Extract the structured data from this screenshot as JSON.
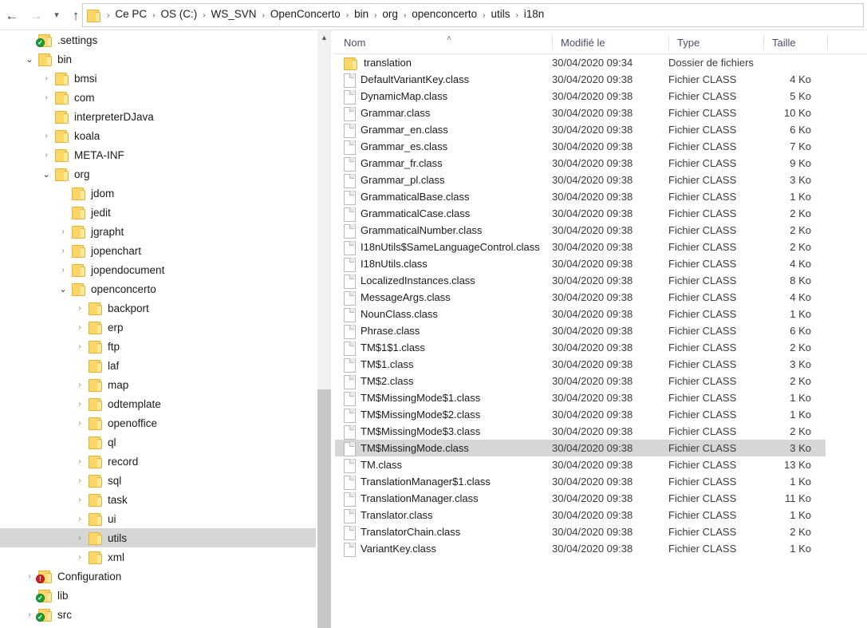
{
  "navigation": {
    "back_icon": "arrow-left-icon",
    "forward_icon": "arrow-right-icon",
    "recent_icon": "chevron-down-icon",
    "up_icon": "arrow-up-icon",
    "breadcrumb_icon": "folder-icon",
    "separator": "›",
    "breadcrumbs": [
      "Ce PC",
      "OS (C:)",
      "WS_SVN",
      "OpenConcerto",
      "bin",
      "org",
      "openconcerto",
      "utils",
      "i18n"
    ]
  },
  "sidebar": {
    "scroll_up_icon": "chevron-up-icon",
    "items": [
      {
        "label": ".settings",
        "depth": 1,
        "state": "leaf",
        "icon": "folder-icon",
        "overlay": "svn-ok-badge",
        "selected": false
      },
      {
        "label": "bin",
        "depth": 1,
        "state": "expanded",
        "icon": "folder-icon",
        "overlay": null,
        "selected": false
      },
      {
        "label": "bmsi",
        "depth": 2,
        "state": "collapsed",
        "icon": "folder-icon",
        "overlay": null,
        "selected": false
      },
      {
        "label": "com",
        "depth": 2,
        "state": "collapsed",
        "icon": "folder-icon",
        "overlay": null,
        "selected": false
      },
      {
        "label": "interpreterDJava",
        "depth": 2,
        "state": "leaf",
        "icon": "folder-icon",
        "overlay": null,
        "selected": false
      },
      {
        "label": "koala",
        "depth": 2,
        "state": "collapsed",
        "icon": "folder-icon",
        "overlay": null,
        "selected": false
      },
      {
        "label": "META-INF",
        "depth": 2,
        "state": "collapsed",
        "icon": "folder-icon",
        "overlay": null,
        "selected": false
      },
      {
        "label": "org",
        "depth": 2,
        "state": "expanded",
        "icon": "folder-icon",
        "overlay": null,
        "selected": false
      },
      {
        "label": "jdom",
        "depth": 3,
        "state": "leaf",
        "icon": "folder-icon",
        "overlay": null,
        "selected": false
      },
      {
        "label": "jedit",
        "depth": 3,
        "state": "leaf",
        "icon": "folder-icon",
        "overlay": null,
        "selected": false
      },
      {
        "label": "jgrapht",
        "depth": 3,
        "state": "collapsed",
        "icon": "folder-icon",
        "overlay": null,
        "selected": false
      },
      {
        "label": "jopenchart",
        "depth": 3,
        "state": "collapsed",
        "icon": "folder-icon",
        "overlay": null,
        "selected": false
      },
      {
        "label": "jopendocument",
        "depth": 3,
        "state": "collapsed",
        "icon": "folder-icon",
        "overlay": null,
        "selected": false
      },
      {
        "label": "openconcerto",
        "depth": 3,
        "state": "expanded",
        "icon": "folder-icon",
        "overlay": null,
        "selected": false
      },
      {
        "label": "backport",
        "depth": 4,
        "state": "collapsed",
        "icon": "folder-icon",
        "overlay": null,
        "selected": false
      },
      {
        "label": "erp",
        "depth": 4,
        "state": "collapsed",
        "icon": "folder-icon",
        "overlay": null,
        "selected": false
      },
      {
        "label": "ftp",
        "depth": 4,
        "state": "collapsed",
        "icon": "folder-icon",
        "overlay": null,
        "selected": false
      },
      {
        "label": "laf",
        "depth": 4,
        "state": "leaf",
        "icon": "folder-icon",
        "overlay": null,
        "selected": false
      },
      {
        "label": "map",
        "depth": 4,
        "state": "collapsed",
        "icon": "folder-icon",
        "overlay": null,
        "selected": false
      },
      {
        "label": "odtemplate",
        "depth": 4,
        "state": "collapsed",
        "icon": "folder-icon",
        "overlay": null,
        "selected": false
      },
      {
        "label": "openoffice",
        "depth": 4,
        "state": "collapsed",
        "icon": "folder-icon",
        "overlay": null,
        "selected": false
      },
      {
        "label": "ql",
        "depth": 4,
        "state": "leaf",
        "icon": "folder-icon",
        "overlay": null,
        "selected": false
      },
      {
        "label": "record",
        "depth": 4,
        "state": "collapsed",
        "icon": "folder-icon",
        "overlay": null,
        "selected": false
      },
      {
        "label": "sql",
        "depth": 4,
        "state": "collapsed",
        "icon": "folder-icon",
        "overlay": null,
        "selected": false
      },
      {
        "label": "task",
        "depth": 4,
        "state": "collapsed",
        "icon": "folder-icon",
        "overlay": null,
        "selected": false
      },
      {
        "label": "ui",
        "depth": 4,
        "state": "collapsed",
        "icon": "folder-icon",
        "overlay": null,
        "selected": false
      },
      {
        "label": "utils",
        "depth": 4,
        "state": "collapsed",
        "icon": "folder-icon",
        "overlay": null,
        "selected": true
      },
      {
        "label": "xml",
        "depth": 4,
        "state": "collapsed",
        "icon": "folder-icon",
        "overlay": null,
        "selected": false
      },
      {
        "label": "Configuration",
        "depth": 1,
        "state": "collapsed",
        "icon": "folder-icon",
        "overlay": "svn-warn-badge",
        "selected": false
      },
      {
        "label": "lib",
        "depth": 1,
        "state": "leaf",
        "icon": "folder-icon",
        "overlay": "svn-ok-badge",
        "selected": false
      },
      {
        "label": "src",
        "depth": 1,
        "state": "collapsed",
        "icon": "folder-icon",
        "overlay": "svn-ok-badge",
        "selected": false
      }
    ]
  },
  "filelist": {
    "columns": [
      "Nom",
      "Modifié le",
      "Type",
      "Taille"
    ],
    "sort_indicator": "˄",
    "rows": [
      {
        "name": "translation",
        "modified": "30/04/2020 09:34",
        "type": "Dossier de fichiers",
        "size": "",
        "icon": "folder-icon",
        "selected": false
      },
      {
        "name": "DefaultVariantKey.class",
        "modified": "30/04/2020 09:38",
        "type": "Fichier CLASS",
        "size": "4 Ko",
        "icon": "file-icon",
        "selected": false
      },
      {
        "name": "DynamicMap.class",
        "modified": "30/04/2020 09:38",
        "type": "Fichier CLASS",
        "size": "5 Ko",
        "icon": "file-icon",
        "selected": false
      },
      {
        "name": "Grammar.class",
        "modified": "30/04/2020 09:38",
        "type": "Fichier CLASS",
        "size": "10 Ko",
        "icon": "file-icon",
        "selected": false
      },
      {
        "name": "Grammar_en.class",
        "modified": "30/04/2020 09:38",
        "type": "Fichier CLASS",
        "size": "6 Ko",
        "icon": "file-icon",
        "selected": false
      },
      {
        "name": "Grammar_es.class",
        "modified": "30/04/2020 09:38",
        "type": "Fichier CLASS",
        "size": "7 Ko",
        "icon": "file-icon",
        "selected": false
      },
      {
        "name": "Grammar_fr.class",
        "modified": "30/04/2020 09:38",
        "type": "Fichier CLASS",
        "size": "9 Ko",
        "icon": "file-icon",
        "selected": false
      },
      {
        "name": "Grammar_pl.class",
        "modified": "30/04/2020 09:38",
        "type": "Fichier CLASS",
        "size": "3 Ko",
        "icon": "file-icon",
        "selected": false
      },
      {
        "name": "GrammaticalBase.class",
        "modified": "30/04/2020 09:38",
        "type": "Fichier CLASS",
        "size": "1 Ko",
        "icon": "file-icon",
        "selected": false
      },
      {
        "name": "GrammaticalCase.class",
        "modified": "30/04/2020 09:38",
        "type": "Fichier CLASS",
        "size": "2 Ko",
        "icon": "file-icon",
        "selected": false
      },
      {
        "name": "GrammaticalNumber.class",
        "modified": "30/04/2020 09:38",
        "type": "Fichier CLASS",
        "size": "2 Ko",
        "icon": "file-icon",
        "selected": false
      },
      {
        "name": "I18nUtils$SameLanguageControl.class",
        "modified": "30/04/2020 09:38",
        "type": "Fichier CLASS",
        "size": "2 Ko",
        "icon": "file-icon",
        "selected": false
      },
      {
        "name": "I18nUtils.class",
        "modified": "30/04/2020 09:38",
        "type": "Fichier CLASS",
        "size": "4 Ko",
        "icon": "file-icon",
        "selected": false
      },
      {
        "name": "LocalizedInstances.class",
        "modified": "30/04/2020 09:38",
        "type": "Fichier CLASS",
        "size": "8 Ko",
        "icon": "file-icon",
        "selected": false
      },
      {
        "name": "MessageArgs.class",
        "modified": "30/04/2020 09:38",
        "type": "Fichier CLASS",
        "size": "4 Ko",
        "icon": "file-icon",
        "selected": false
      },
      {
        "name": "NounClass.class",
        "modified": "30/04/2020 09:38",
        "type": "Fichier CLASS",
        "size": "1 Ko",
        "icon": "file-icon",
        "selected": false
      },
      {
        "name": "Phrase.class",
        "modified": "30/04/2020 09:38",
        "type": "Fichier CLASS",
        "size": "6 Ko",
        "icon": "file-icon",
        "selected": false
      },
      {
        "name": "TM$1$1.class",
        "modified": "30/04/2020 09:38",
        "type": "Fichier CLASS",
        "size": "2 Ko",
        "icon": "file-icon",
        "selected": false
      },
      {
        "name": "TM$1.class",
        "modified": "30/04/2020 09:38",
        "type": "Fichier CLASS",
        "size": "3 Ko",
        "icon": "file-icon",
        "selected": false
      },
      {
        "name": "TM$2.class",
        "modified": "30/04/2020 09:38",
        "type": "Fichier CLASS",
        "size": "2 Ko",
        "icon": "file-icon",
        "selected": false
      },
      {
        "name": "TM$MissingMode$1.class",
        "modified": "30/04/2020 09:38",
        "type": "Fichier CLASS",
        "size": "1 Ko",
        "icon": "file-icon",
        "selected": false
      },
      {
        "name": "TM$MissingMode$2.class",
        "modified": "30/04/2020 09:38",
        "type": "Fichier CLASS",
        "size": "1 Ko",
        "icon": "file-icon",
        "selected": false
      },
      {
        "name": "TM$MissingMode$3.class",
        "modified": "30/04/2020 09:38",
        "type": "Fichier CLASS",
        "size": "2 Ko",
        "icon": "file-icon",
        "selected": false
      },
      {
        "name": "TM$MissingMode.class",
        "modified": "30/04/2020 09:38",
        "type": "Fichier CLASS",
        "size": "3 Ko",
        "icon": "file-icon",
        "selected": true
      },
      {
        "name": "TM.class",
        "modified": "30/04/2020 09:38",
        "type": "Fichier CLASS",
        "size": "13 Ko",
        "icon": "file-icon",
        "selected": false
      },
      {
        "name": "TranslationManager$1.class",
        "modified": "30/04/2020 09:38",
        "type": "Fichier CLASS",
        "size": "1 Ko",
        "icon": "file-icon",
        "selected": false
      },
      {
        "name": "TranslationManager.class",
        "modified": "30/04/2020 09:38",
        "type": "Fichier CLASS",
        "size": "11 Ko",
        "icon": "file-icon",
        "selected": false
      },
      {
        "name": "Translator.class",
        "modified": "30/04/2020 09:38",
        "type": "Fichier CLASS",
        "size": "1 Ko",
        "icon": "file-icon",
        "selected": false
      },
      {
        "name": "TranslatorChain.class",
        "modified": "30/04/2020 09:38",
        "type": "Fichier CLASS",
        "size": "2 Ko",
        "icon": "file-icon",
        "selected": false
      },
      {
        "name": "VariantKey.class",
        "modified": "30/04/2020 09:38",
        "type": "Fichier CLASS",
        "size": "1 Ko",
        "icon": "file-icon",
        "selected": false
      }
    ]
  },
  "colors": {
    "selection": "#d6d6d6",
    "folder": "#fcd667",
    "header_text": "#4a4e68",
    "svn_ok": "#1f9d35",
    "svn_warn": "#cf2020"
  }
}
